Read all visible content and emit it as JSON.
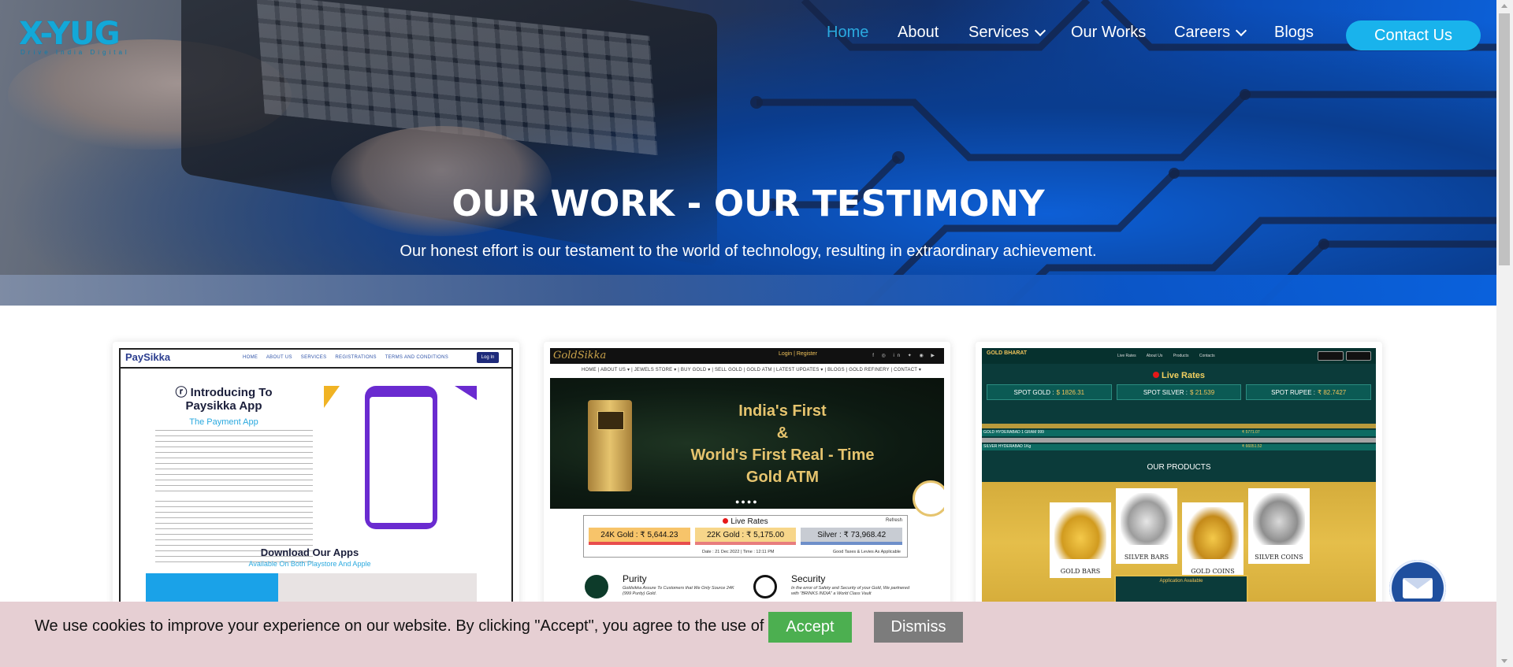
{
  "brand": {
    "logo_text": "X-YUG",
    "tagline": "Drive India Digital"
  },
  "nav": {
    "items": [
      {
        "label": "Home",
        "active": true,
        "dropdown": false
      },
      {
        "label": "About",
        "active": false,
        "dropdown": false
      },
      {
        "label": "Services",
        "active": false,
        "dropdown": true
      },
      {
        "label": "Our Works",
        "active": false,
        "dropdown": false
      },
      {
        "label": "Careers",
        "active": false,
        "dropdown": true
      },
      {
        "label": "Blogs",
        "active": false,
        "dropdown": false
      }
    ],
    "contact_label": "Contact Us"
  },
  "hero": {
    "title": "OUR WORK - OUR TESTIMONY",
    "subtitle": "Our honest effort is our testament to the world of technology, resulting in extraordinary achievement."
  },
  "cards": {
    "paysikka": {
      "logo": "PaySikka",
      "menu": [
        "HOME",
        "ABOUT US",
        "SERVICES",
        "REGISTRATIONS",
        "TERMS AND CONDITIONS"
      ],
      "login": "Log In",
      "heading": "Introducing To Paysikka App",
      "subheading": "The Payment App",
      "download": "Download Our Apps",
      "available": "Available On Both Playstore And Apple"
    },
    "goldsikka": {
      "logo": "GoldSikka",
      "top_links": "Login  |  Register",
      "menu": "HOME | ABOUT US ▾ | JEWELS STORE ▾ | BUY GOLD ▾ | SELL GOLD | GOLD ATM | LATEST UPDATES ▾ | BLOGS | GOLD REFINERY | CONTACT ▾",
      "banner_line1": "India's First",
      "banner_line2": "&",
      "banner_line3": "World's First Real - Time",
      "banner_line4": "Gold ATM",
      "live_rates": "Live Rates",
      "refresh": "Refresh",
      "rate_24k": "24K Gold : ₹ 5,644.23",
      "rate_22k": "22K Gold : ₹ 5,175.00",
      "rate_silver": "Silver : ₹ 73,968.42",
      "date": "Date : 21 Dec 2022  |  Time : 12:11 PM",
      "taxes": "Good Taxes & Levies As Applicable",
      "feature1_title": "Purity",
      "feature1_text": "Goldsikka Assure To Customers that We Only Source 24K (999 Purity) Gold.",
      "feature2_title": "Security",
      "feature2_text": "In the error of Safety and Security of your Gold, We partnered with \"BRINKS INDIA\" a World Class Vault"
    },
    "goldbharat": {
      "logo": "GOLD BHARAT",
      "menu": [
        "Live Rates",
        "About Us",
        "Products",
        "Contacts"
      ],
      "live_rates": "Live Rates",
      "spot_gold": "SPOT GOLD :",
      "spot_gold_val": "$ 1826.31",
      "spot_silver": "SPOT SILVER :",
      "spot_silver_val": "$ 21.539",
      "spot_rupee": "SPOT RUPEE :",
      "spot_rupee_val": "₹ 82.7427",
      "row1": "GOLD HYDERABAD 1 GRAM 999",
      "row1_val": "₹ 5771.07",
      "row2": "SILVER HYDERABAD 1Kg",
      "row2_val": "₹ 66051.52",
      "our_products": "OUR PRODUCTS",
      "products": [
        "GOLD BARS",
        "SILVER BARS",
        "GOLD COINS",
        "SILVER COINS"
      ],
      "app_available": "Application Available"
    }
  },
  "cookie": {
    "message": "We use cookies to improve your experience on our website. By clicking \"Accept\", you agree to the use of cookies.",
    "accept": "Accept",
    "dismiss": "Dismiss"
  },
  "colors": {
    "accent": "#19b3ec",
    "accept": "#4caf50",
    "dismiss": "#7c7c7c",
    "cookie_bg": "#e6cfd3"
  }
}
